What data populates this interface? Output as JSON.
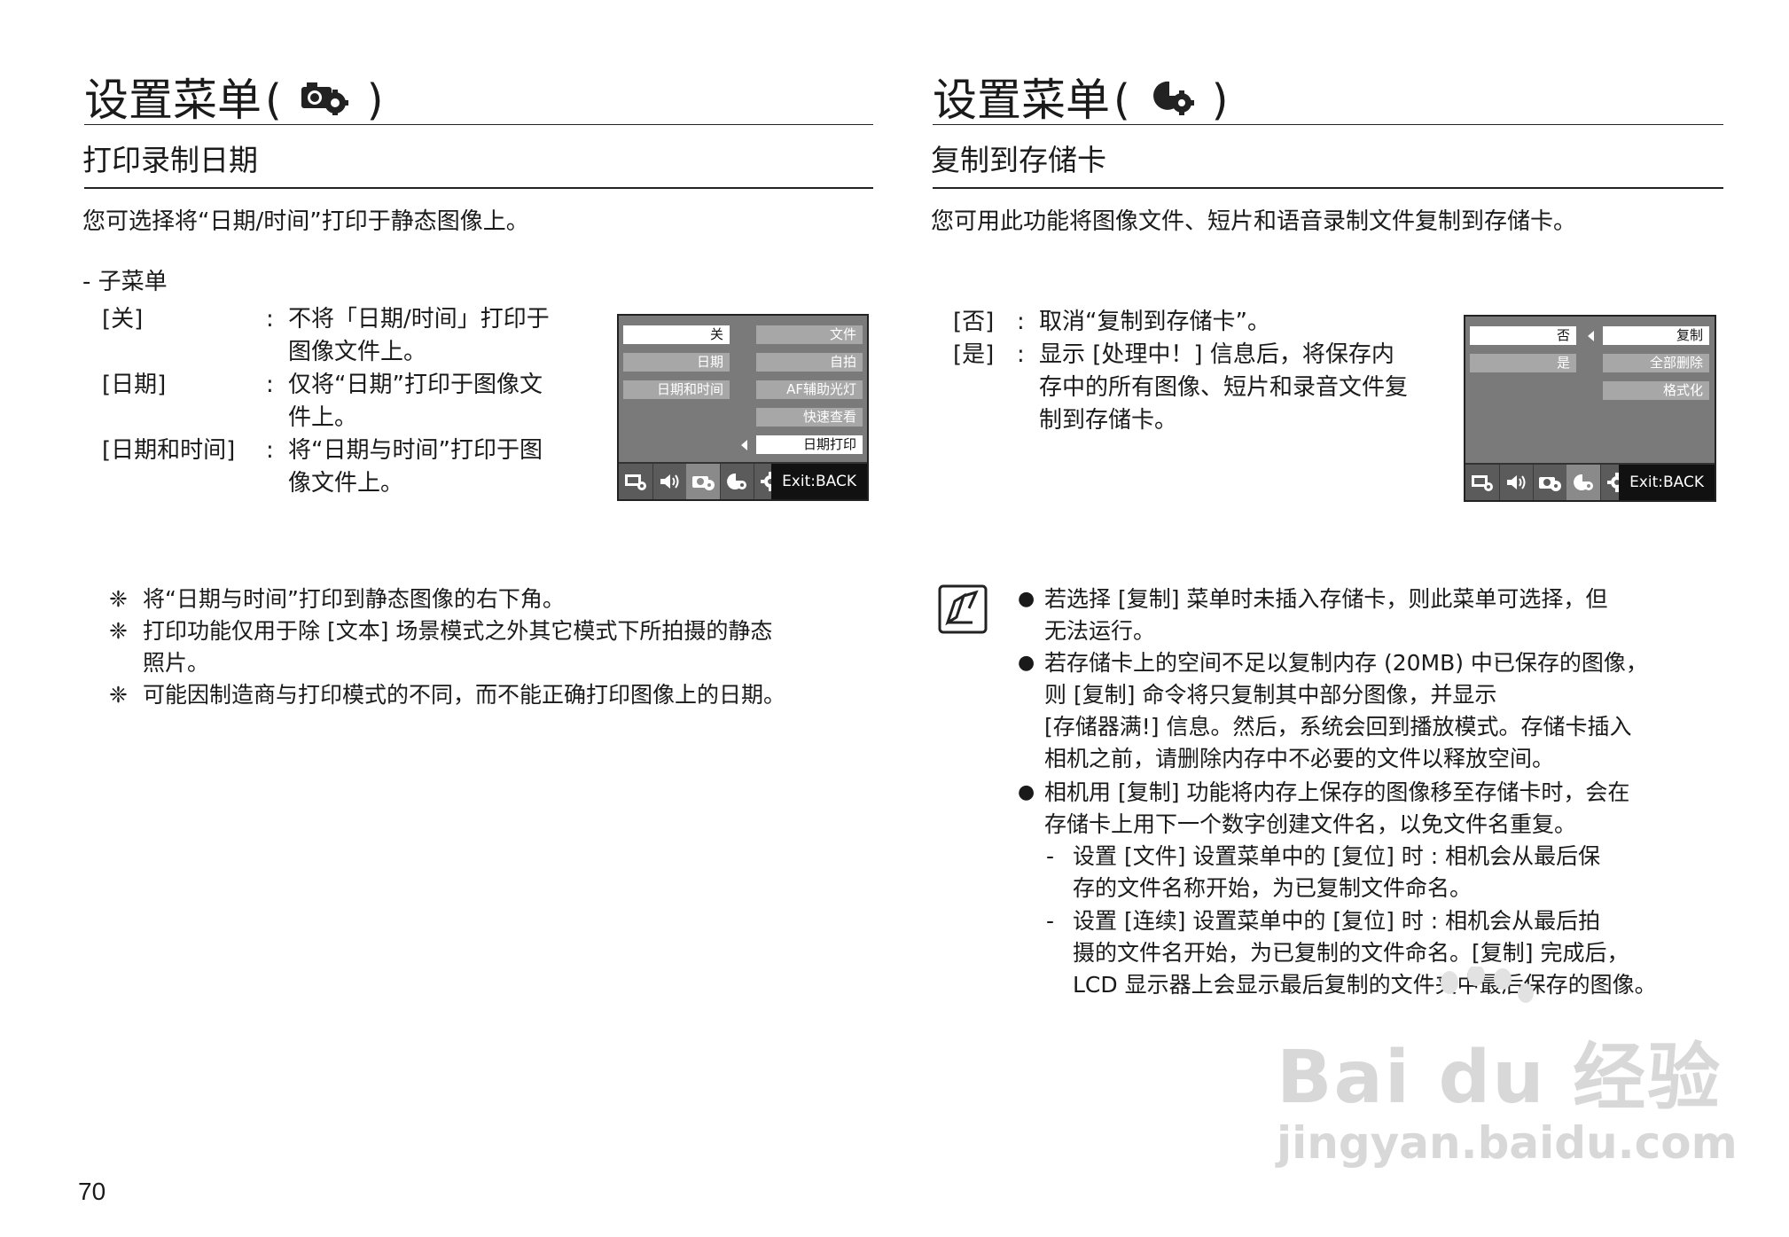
{
  "left": {
    "title": "设置菜单",
    "paren_open": "(",
    "paren_close": ")",
    "title_icon": "camera-settings-icon",
    "section": "打印录制日期",
    "intro": "您可选择将“日期/时间”打印于静态图像上。",
    "submenu_label": "- 子菜单",
    "definitions": [
      {
        "term": "[关]",
        "colon": ":",
        "lines": [
          "不将「日期/时间」打印于",
          "图像文件上。"
        ]
      },
      {
        "term": "[日期]",
        "colon": ":",
        "lines": [
          "仅将“日期”打印于图像文",
          "件上。"
        ]
      },
      {
        "term": "[日期和时间]",
        "colon": ":",
        "lines": [
          "将“日期与时间”打印于图",
          "像文件上。"
        ]
      }
    ],
    "lcd": {
      "left_items": [
        "关",
        "日期",
        "日期和时间"
      ],
      "right_items": [
        "文件",
        "自拍",
        "AF辅助光灯",
        "快速查看",
        "日期打印"
      ],
      "exit": "Exit:BACK"
    },
    "notes": [
      {
        "mark": "❈",
        "lines": [
          "将“日期与时间”打印到静态图像的右下角。"
        ]
      },
      {
        "mark": "❈",
        "lines": [
          "打印功能仅用于除 [文本] 场景模式之外其它模式下所拍摄的静态",
          "照片。"
        ]
      },
      {
        "mark": "❈",
        "lines": [
          "可能因制造商与打印模式的不同，而不能正确打印图像上的日期。"
        ]
      }
    ]
  },
  "right": {
    "title": "设置菜单",
    "paren_open": "(",
    "paren_close": ")",
    "title_icon": "playback-settings-icon",
    "section": "复制到存储卡",
    "intro": "您可用此功能将图像文件、短片和语音录制文件复制到存储卡。",
    "definitions": [
      {
        "term": "[否]",
        "colon": ":",
        "lines": [
          "取消“复制到存储卡”。"
        ]
      },
      {
        "term": "[是]",
        "colon": ":",
        "lines": [
          "显示 [处理中！] 信息后，将保存内",
          "存中的所有图像、短片和录音文件复",
          "制到存储卡。"
        ]
      }
    ],
    "lcd": {
      "left_items": [
        "否",
        "是"
      ],
      "right_items": [
        "复制",
        "全部删除",
        "格式化"
      ],
      "exit": "Exit:BACK"
    },
    "bullets": [
      {
        "mark": "●",
        "lines": [
          "若选择 [复制] 菜单时未插入存储卡，则此菜单可选择，但",
          "无法运行。"
        ]
      },
      {
        "mark": "●",
        "lines": [
          "若存储卡上的空间不足以复制内存 (20MB) 中已保存的图像，",
          "则 [复制] 命令将只复制其中部分图像，并显示",
          "[存储器满!] 信息。然后，系统会回到播放模式。存储卡插入",
          "相机之前，请删除内存中不必要的文件以释放空间。"
        ]
      },
      {
        "mark": "●",
        "lines": [
          "相机用 [复制] 功能将内存上保存的图像移至存储卡时，会在",
          "存储卡上用下一个数字创建文件名，以免文件名重复。"
        ]
      }
    ],
    "subitems": [
      {
        "mark": "-",
        "lines": [
          "设置 [文件] 设置菜单中的 [复位] 时 : 相机会从最后保",
          "存的文件名称开始，为已复制文件命名。"
        ]
      },
      {
        "mark": "-",
        "lines": [
          "设置 [连续] 设置菜单中的 [复位] 时 : 相机会从最后拍",
          "摄的文件名开始，为已复制的文件命名。[复制] 完成后，",
          "LCD 显示器上会显示最后复制的文件夹中最后保存的图像。"
        ]
      }
    ]
  },
  "page_number": "70",
  "watermark": {
    "logo": "Bai du 经验",
    "url": "jingyan.baidu.com"
  }
}
